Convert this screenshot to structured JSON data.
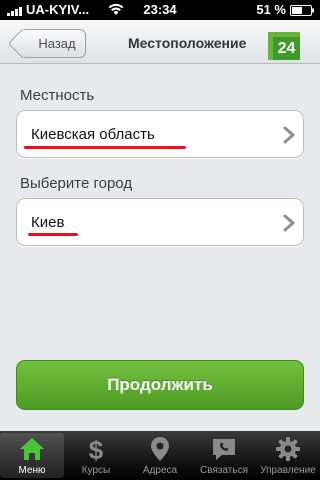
{
  "status_bar": {
    "carrier": "UA-KYIV...",
    "time": "23:34",
    "battery": "51 %"
  },
  "nav": {
    "back_label": "Назад",
    "title": "Местоположение",
    "logo_text": "24"
  },
  "form": {
    "region_label": "Местность",
    "region_value": "Киевская область",
    "city_label": "Выберите город",
    "city_value": "Киев"
  },
  "continue_label": "Продолжить",
  "tabs": [
    {
      "label": "Меню",
      "icon": "home-icon",
      "active": true
    },
    {
      "label": "Курсы",
      "icon": "dollar-icon",
      "active": false
    },
    {
      "label": "Адреса",
      "icon": "location-pin-icon",
      "active": false
    },
    {
      "label": "Связаться",
      "icon": "phone-chat-icon",
      "active": false
    },
    {
      "label": "Управление",
      "icon": "gear-icon",
      "active": false
    }
  ],
  "colors": {
    "accent_green": "#4d9b25",
    "underline_red": "#ef0d19",
    "active_tab_icon": "#4cc43a"
  }
}
